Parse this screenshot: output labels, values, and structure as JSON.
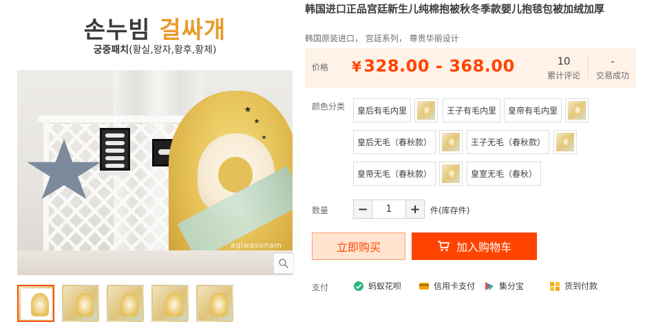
{
  "gallery": {
    "brand_korean_dark": "손누빔",
    "brand_korean_orange": "걸싸개",
    "brand_sub_bold": "궁중패치",
    "brand_sub_rest": "(황실,왕자,황후,황제)",
    "watermark": "aqiwasonam",
    "thumbnail_count": 5
  },
  "product": {
    "title": "韩国进口正品宫廷新生儿纯棉抱被秋冬季款婴儿抱毯包被加绒加厚",
    "subtitle": "韩国原装进口， 宫廷系列， 尊贵华丽设计"
  },
  "price": {
    "label": "价格",
    "currency": "¥",
    "range": "328.00 - 368.00",
    "reviews_count": "10",
    "reviews_label": "累计评论",
    "sales_count": "-",
    "sales_label": "交易成功"
  },
  "options": {
    "color_label": "颜色分类",
    "items": [
      "皇后有毛内里",
      "王子有毛内里",
      "皇帝有毛内里",
      "皇后无毛（春秋款）",
      "王子无毛（春秋款）",
      "皇帝无毛（春秋款）",
      "皇室无毛（春秋）"
    ]
  },
  "quantity": {
    "label": "数量",
    "minus": "−",
    "plus": "+",
    "value": "1",
    "unit": "件(库存件)"
  },
  "actions": {
    "buy_now": "立即购买",
    "add_to_cart": "加入购物车"
  },
  "payment": {
    "label": "支付",
    "methods": [
      "蚂蚁花呗",
      "信用卡支付",
      "集分宝",
      "货到付款"
    ]
  },
  "colors": {
    "accent": "#ff4400",
    "price_bg": "#fff2e8",
    "active_border": "#ff5000"
  }
}
